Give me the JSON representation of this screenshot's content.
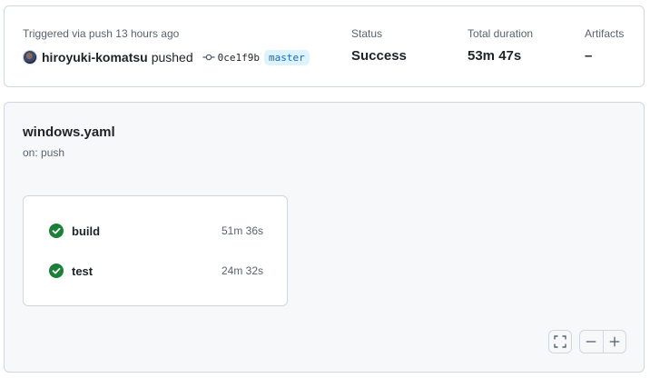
{
  "summary": {
    "trigger_text": "Triggered via push 13 hours ago",
    "username": "hiroyuki-komatsu",
    "action": "pushed",
    "commit_sha": "0ce1f9b",
    "branch": "master",
    "status_label": "Status",
    "status_value": "Success",
    "duration_label": "Total duration",
    "duration_value": "53m 47s",
    "artifacts_label": "Artifacts",
    "artifacts_value": "–"
  },
  "workflow": {
    "file_name": "windows.yaml",
    "trigger": "on: push",
    "jobs": [
      {
        "name": "build",
        "duration": "51m 36s",
        "status": "success"
      },
      {
        "name": "test",
        "duration": "24m 32s",
        "status": "success"
      }
    ]
  },
  "icons": {
    "success_color": "#1a7f37",
    "commit": "git-commit-icon",
    "fullscreen": "fullscreen-icon",
    "zoom_out": "minus-icon",
    "zoom_in": "plus-icon"
  }
}
